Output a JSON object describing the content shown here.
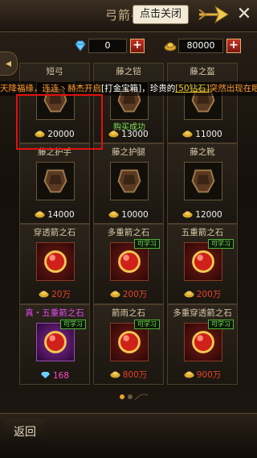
{
  "header": {
    "title": "弓箭手",
    "close_tip": "点击关闭",
    "close_label": "✕"
  },
  "currency": {
    "gems": "0",
    "gold": "80000",
    "plus": "+"
  },
  "side_tab": {
    "label": "◂"
  },
  "marquee": {
    "part1": "天降福缘，连连丶赫杰开启",
    "part2": "[打金宝箱]",
    "part3": "，珍贵的",
    "part4": "[50钻石]",
    "part5": "突然出现在眼前!"
  },
  "purchase": {
    "status": "购买成功"
  },
  "items": [
    {
      "name": "短弓",
      "price": "20000",
      "currency": "gold",
      "kind": "gear",
      "learn": ""
    },
    {
      "name": "藤之铠",
      "price": "13000",
      "currency": "gold",
      "kind": "gear",
      "learn": ""
    },
    {
      "name": "藤之盔",
      "price": "11000",
      "currency": "gold",
      "kind": "gear",
      "learn": ""
    },
    {
      "name": "藤之护手",
      "price": "14000",
      "currency": "gold",
      "kind": "gear",
      "learn": ""
    },
    {
      "name": "藤之护腿",
      "price": "10000",
      "currency": "gold",
      "kind": "gear",
      "learn": ""
    },
    {
      "name": "藤之靴",
      "price": "12000",
      "currency": "gold",
      "kind": "gear",
      "learn": ""
    },
    {
      "name": "穿透箭之石",
      "price": "20万",
      "currency": "gold",
      "kind": "stone",
      "learn": ""
    },
    {
      "name": "多重箭之石",
      "price": "200万",
      "currency": "gold",
      "kind": "stone",
      "learn": "可学习"
    },
    {
      "name": "五重箭之石",
      "price": "200万",
      "currency": "gold",
      "kind": "stone",
      "learn": "可学习"
    },
    {
      "name": "真・五重箭之石",
      "price": "168",
      "currency": "gem",
      "kind": "stone-purple",
      "learn": "可学习"
    },
    {
      "name": "箭雨之石",
      "price": "800万",
      "currency": "gold",
      "kind": "stone",
      "learn": "可学习"
    },
    {
      "name": "多重穿透箭之石",
      "price": "900万",
      "currency": "gold",
      "kind": "stone",
      "learn": "可学习"
    }
  ],
  "footer": {
    "back_label": "返回"
  },
  "colors": {
    "accent": "#e8c070",
    "learn": "#7de056",
    "price_red": "#e8432a",
    "price_pink": "#ff4bcc"
  }
}
